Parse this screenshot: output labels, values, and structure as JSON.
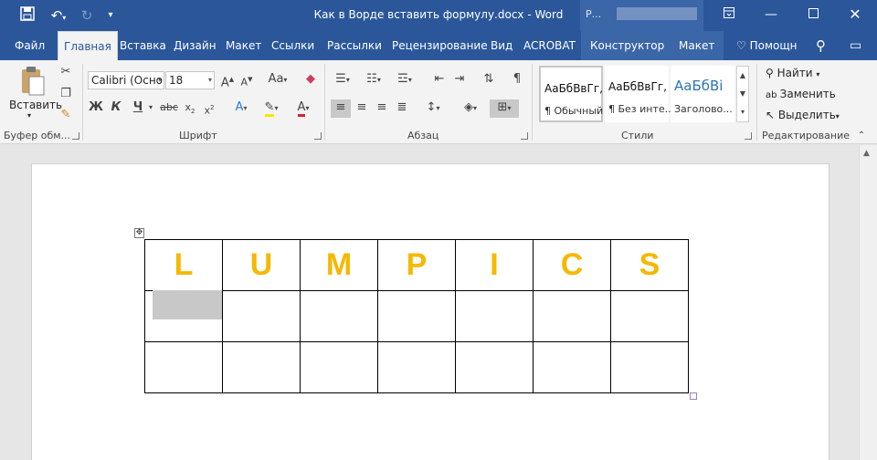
{
  "titlebar": {
    "title": "Как в Ворде вставить формулу.docx - Word",
    "context_label": "Р..."
  },
  "tabs": [
    {
      "label": "Файл"
    },
    {
      "label": "Главная"
    },
    {
      "label": "Вставка"
    },
    {
      "label": "Дизайн"
    },
    {
      "label": "Макет"
    },
    {
      "label": "Ссылки"
    },
    {
      "label": "Рассылки"
    },
    {
      "label": "Рецензирование"
    },
    {
      "label": "Вид"
    },
    {
      "label": "ACROBAT"
    },
    {
      "label": "Конструктор"
    },
    {
      "label": "Макет"
    }
  ],
  "tell_me": "Помощн",
  "ribbon": {
    "clipboard": {
      "paste_label": "Вставить",
      "group_label": "Буфер обм..."
    },
    "font": {
      "font_name": "Calibri (Осно",
      "font_size": "18",
      "case_label": "Aa",
      "bold": "Ж",
      "italic": "К",
      "underline": "Ч",
      "strike": "abc",
      "group_label": "Шрифт"
    },
    "paragraph": {
      "group_label": "Абзац"
    },
    "styles": {
      "items": [
        {
          "sample": "АаБбВвГг,",
          "name": "¶ Обычный"
        },
        {
          "sample": "АаБбВвГг,",
          "name": "¶ Без инте..."
        },
        {
          "sample": "АаБбВі",
          "name": "Заголово..."
        }
      ],
      "group_label": "Стили"
    },
    "editing": {
      "find": "Найти",
      "replace": "Заменить",
      "select": "Выделить",
      "group_label": "Редактирование"
    }
  },
  "table": {
    "header_letters": [
      "L",
      "U",
      "M",
      "P",
      "I",
      "C",
      "S"
    ],
    "rows": 3,
    "cols": 7,
    "letter_color": "#f5b800"
  },
  "colors": {
    "accent": "#2b579a"
  }
}
